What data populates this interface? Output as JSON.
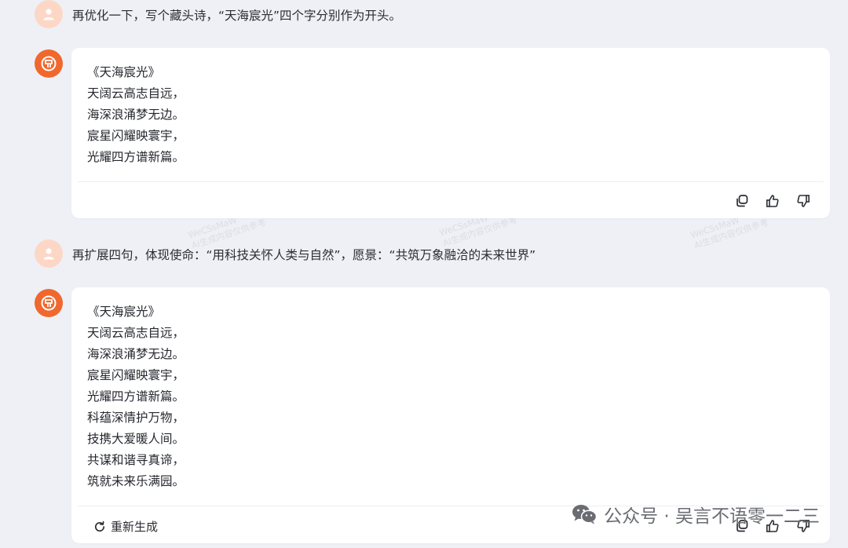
{
  "conversation": {
    "msg1": {
      "user_text": "再优化一下，写个藏头诗，“天海宸光”四个字分别作为开头。"
    },
    "reply1": {
      "lines": [
        "《天海宸光》",
        "天阔云高志自远，",
        "海深浪涌梦无边。",
        "宸星闪耀映寰宇，",
        "光耀四方谱新篇。"
      ]
    },
    "msg2": {
      "user_text": "再扩展四句，体现使命：“用科技关怀人类与自然”，愿景：“共筑万象融洽的未来世界”"
    },
    "reply2": {
      "lines": [
        "《天海宸光》",
        "天阔云高志自远，",
        "海深浪涌梦无边。",
        "宸星闪耀映寰宇，",
        "光耀四方谱新篇。",
        "科蕴深情护万物，",
        "技携大爱暖人间。",
        "共谋和谐寻真谛，",
        "筑就未来乐满园。"
      ],
      "regenerate_label": "重新生成"
    }
  },
  "overlay": {
    "text": "公众号 · 吴言不语零一二三",
    "faint_line1": "WeCSsMaW",
    "faint_line2": "AI生成内容仅供参考"
  },
  "icons": {
    "user_avatar": "user-icon",
    "bot_avatar": "bot-logo-icon",
    "copy": "copy-icon",
    "like": "thumbs-up-icon",
    "dislike": "thumbs-down-icon",
    "regenerate": "refresh-icon",
    "wechat": "wechat-icon"
  },
  "colors": {
    "background": "#eef0f6",
    "bubble": "#ffffff",
    "bot_avatar": "#f0682d",
    "user_avatar": "#fdd7c5"
  }
}
